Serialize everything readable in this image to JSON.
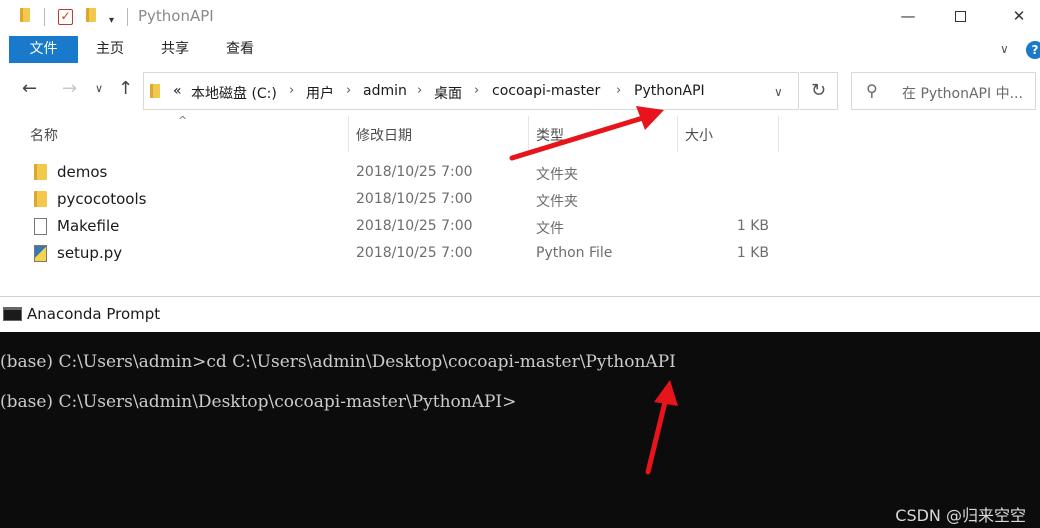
{
  "explorer": {
    "title": "PythonAPI",
    "ribbon_tabs": {
      "file": "文件",
      "home": "主页",
      "share": "共享",
      "view": "查看"
    },
    "help_label": "?",
    "address": {
      "overflow": "«",
      "crumbs": [
        "本地磁盘 (C:)",
        "用户",
        "admin",
        "桌面",
        "cocoapi-master",
        "PythonAPI"
      ]
    },
    "search_placeholder": "在 PythonAPI 中...",
    "columns": {
      "name": "名称",
      "date": "修改日期",
      "type": "类型",
      "size": "大小"
    },
    "files": [
      {
        "name": "demos",
        "date": "2018/10/25 7:00",
        "type": "文件夹",
        "size": "",
        "icon": "folder-icon"
      },
      {
        "name": "pycocotools",
        "date": "2018/10/25 7:00",
        "type": "文件夹",
        "size": "",
        "icon": "folder-icon"
      },
      {
        "name": "Makefile",
        "date": "2018/10/25 7:00",
        "type": "文件",
        "size": "1 KB",
        "icon": "file-icon"
      },
      {
        "name": "setup.py",
        "date": "2018/10/25 7:00",
        "type": "Python File",
        "size": "1 KB",
        "icon": "python-file-icon"
      }
    ]
  },
  "prompt": {
    "title": "Anaconda Prompt",
    "lines": [
      "(base) C:\\Users\\admin>cd C:\\Users\\admin\\Desktop\\cocoapi-master\\PythonAPI",
      "(base) C:\\Users\\admin\\Desktop\\cocoapi-master\\PythonAPI>"
    ]
  },
  "watermark": "CSDN @归来空空",
  "colors": {
    "accent": "#1979ca",
    "console_bg": "#0c0c0c",
    "console_text": "#cccccc",
    "annotation_arrow": "#e8141c"
  }
}
